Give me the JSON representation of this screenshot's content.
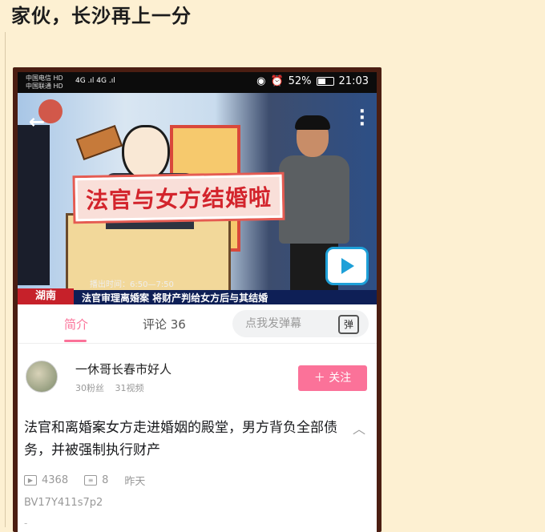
{
  "post": {
    "title": "家伙，长沙再上一分"
  },
  "statusbar": {
    "carrier1": "中国电信 HD",
    "carrier2": "中国联通 HD",
    "signal": "4G .ıl 4G .ıl",
    "battery_pct": "52%",
    "time": "21:03"
  },
  "video": {
    "caption": "法官与女方结婚啦",
    "lower_label": "湖南",
    "lower_text": "法官审理离婚案 将财产判给女方后与其结婚",
    "time_slot": "播出时间：6:50—7:50"
  },
  "tabs": {
    "intro": "简介",
    "comments": "评论 36",
    "danmaku_placeholder": "点我发弹幕",
    "danmaku_toggle": "弹"
  },
  "uploader": {
    "name": "一休哥长春市好人",
    "fans": "30粉丝",
    "videos": "31视频",
    "follow_label": "＋ 关注"
  },
  "info": {
    "title": "法官和离婚案女方走进婚姻的殿堂，男方背负全部债务，并被强制执行财产",
    "views": "4368",
    "danmaku_count": "8",
    "date": "昨天",
    "bvid": "BV17Y411s7p2",
    "tail": "-"
  },
  "colors": {
    "accent_pink": "#fb7299",
    "page_bg": "#fdf0d2",
    "caption_red": "#d3242c"
  }
}
